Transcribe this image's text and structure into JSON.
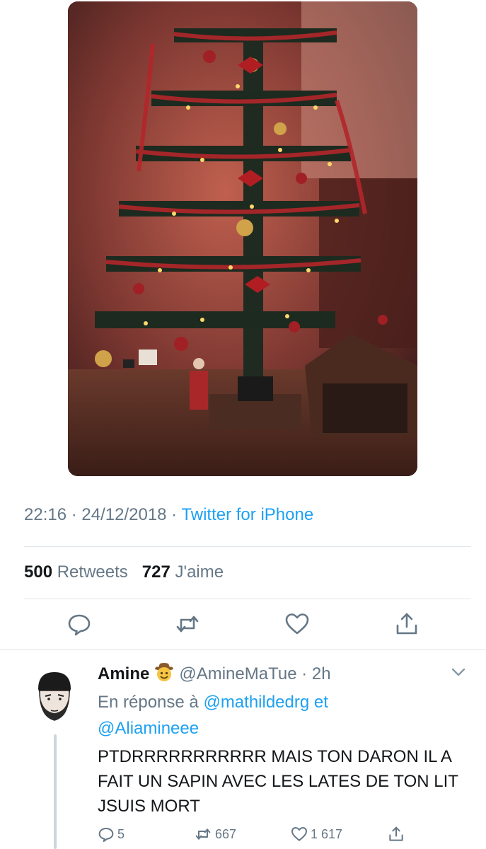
{
  "tweet": {
    "time": "22:16",
    "date": "24/12/2018",
    "separator": " · ",
    "source": "Twitter for iPhone",
    "stats": {
      "retweets_count": "500",
      "retweets_label": "Retweets",
      "likes_count": "727",
      "likes_label": "J'aime"
    },
    "actions": [
      "reply-icon",
      "retweet-icon",
      "like-icon",
      "share-icon"
    ]
  },
  "reply": {
    "name": "Amine",
    "emoji": "cowboy-emoji",
    "handle": "@AmineMaTue",
    "time": "2h",
    "in_reply_prefix": "En réponse à",
    "mention1": "@mathildedrg",
    "and_word": "et",
    "mention2": "@Aliamineee",
    "text": "PTDRRRRRRRRRRR MAIS TON DARON IL A FAIT UN SAPIN AVEC LES LATES DE TON LIT JSUIS MORT",
    "counts": {
      "replies": "5",
      "retweets": "667",
      "likes": "1 617"
    }
  },
  "colors": {
    "accent": "#1da1f2",
    "secondary_text": "#657786",
    "divider": "#e1e8ed"
  }
}
